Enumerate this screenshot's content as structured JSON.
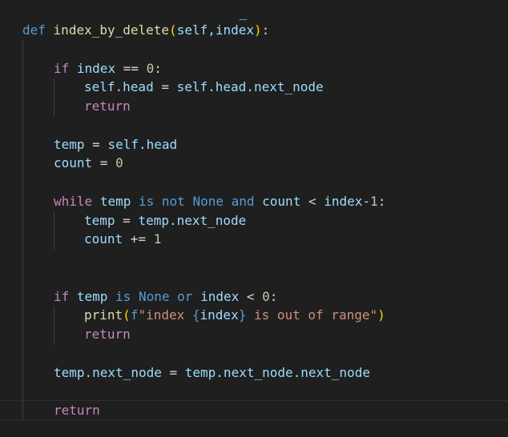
{
  "code": {
    "top_fragment": "_",
    "line_def": {
      "kw": "def",
      "name": "index_by_delete",
      "open": "(",
      "params": "self,index",
      "close": ")",
      "colon": ":"
    },
    "line_if1": {
      "kw": "if",
      "var": "index",
      "op": " == ",
      "num": "0",
      "colon": ":"
    },
    "line_head_assign": {
      "left": "self.head",
      "op": " = ",
      "right": "self.head.next_node"
    },
    "line_return1": {
      "kw": "return"
    },
    "line_temp": {
      "left": "temp",
      "op": " = ",
      "right": "self.head"
    },
    "line_count": {
      "left": "count",
      "op": " = ",
      "num": "0"
    },
    "line_while": {
      "kw": "while",
      "v1": "temp",
      "is": "is",
      "not": "not",
      "none": "None",
      "and": "and",
      "v2": "count",
      "lt": " < ",
      "v3": "index",
      "minus": "-",
      "num": "1",
      "colon": ":"
    },
    "line_temp_next": {
      "left": "temp",
      "op": " = ",
      "right": "temp.next_node"
    },
    "line_count_inc": {
      "left": "count",
      "op": " += ",
      "num": "1"
    },
    "line_if2": {
      "kw": "if",
      "v1": "temp",
      "is": "is",
      "none": "None",
      "or": "or",
      "v2": "index",
      "lt": " < ",
      "num": "0",
      "colon": ":"
    },
    "line_print": {
      "fn": "print",
      "open": "(",
      "f": "f",
      "s1": "\"index ",
      "bo": "{",
      "var": "index",
      "bc": "}",
      "s2": " is out of range\"",
      "close": ")"
    },
    "line_return2": {
      "kw": "return"
    },
    "line_assign_next": {
      "left": "temp.next_node",
      "op": " = ",
      "right": "temp.next_node.next_node"
    },
    "line_return3": {
      "kw": "return"
    }
  }
}
